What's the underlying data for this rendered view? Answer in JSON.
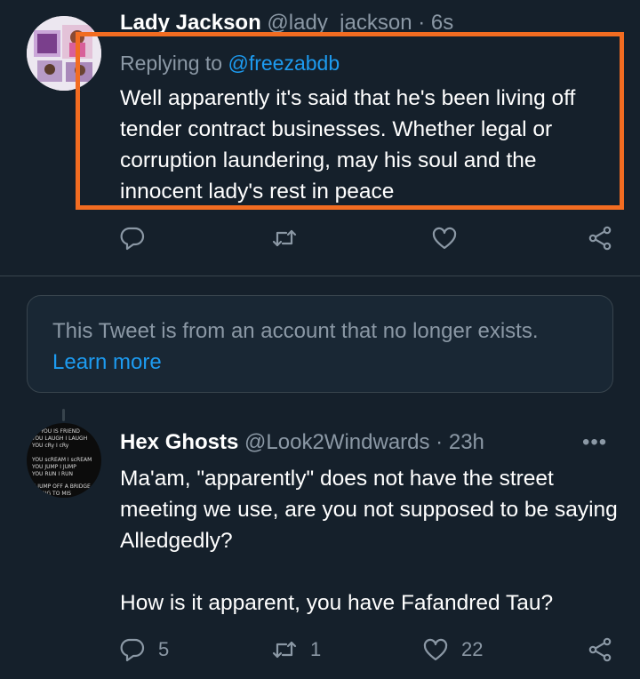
{
  "tweet1": {
    "display_name": "Lady Jackson",
    "handle": "@lady_jackson",
    "dot": "·",
    "time": "6s",
    "replying_to_prefix": "Replying to ",
    "replying_to_handle": "@freezabdb",
    "text": "Well apparently it's said that he's been living off tender contract businesses. Whether legal or corruption laundering, may his soul and the innocent lady's rest in peace",
    "actions": {
      "reply_icon": "reply-icon",
      "retweet_icon": "retweet-icon",
      "like_icon": "heart-icon",
      "share_icon": "share-icon"
    }
  },
  "tombstone": {
    "message": "This Tweet is from an account that no longer exists.",
    "link": "Learn more"
  },
  "tweet2": {
    "display_name": "Hex Ghosts",
    "handle": "@Look2Windwards",
    "dot": "·",
    "time": "23h",
    "more": "•••",
    "paragraph1": "Ma'am, \"apparently\" does not have the street meeting we use, are you not supposed to be saying Alledgedly?",
    "paragraph2": "How is it apparent, you have Fafandred Tau?",
    "reply_count": "5",
    "retweet_count": "1",
    "like_count": "22"
  },
  "avatar2_text": [
    "u YOU IS FRIEND",
    "YOU LAUGH I LAUGH",
    "YOU cRy I cRy",
    "YOU scREAM I scREAM",
    "YOU JUMP I JUMP",
    "YOU RUN I RUN",
    "U JUMP OFF A BRIDGE",
    "NG TO MIS"
  ],
  "colors": {
    "background": "#15202b",
    "accent": "#1d9bf0",
    "muted": "#8b98a5",
    "highlight": "#f26c21",
    "divider": "#38444d"
  }
}
